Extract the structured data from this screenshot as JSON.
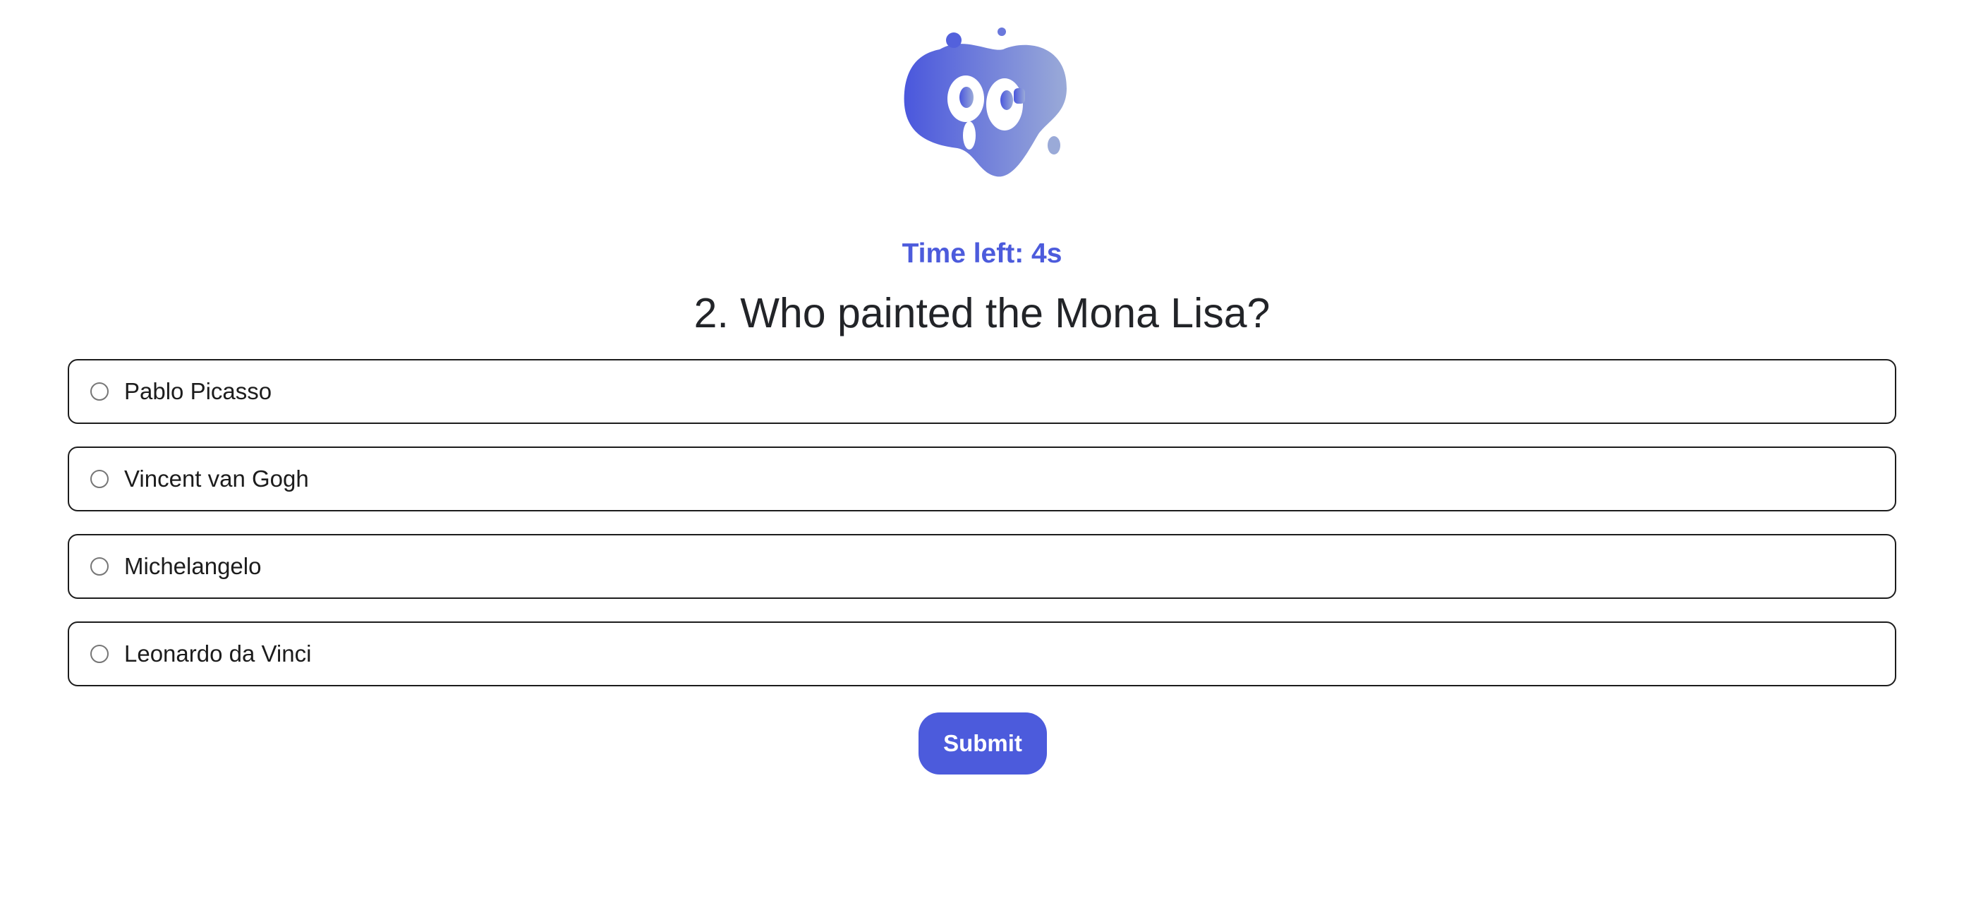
{
  "app": {
    "logo_icon": "qc-blob-logo",
    "logo_text": "QC",
    "accent_color": "#4c5bdc"
  },
  "quiz": {
    "timer_text": "Time left: 4s",
    "question": "2. Who painted the Mona Lisa?",
    "options": [
      {
        "label": "Pablo Picasso",
        "selected": false
      },
      {
        "label": "Vincent van Gogh",
        "selected": false
      },
      {
        "label": "Michelangelo",
        "selected": false
      },
      {
        "label": "Leonardo da Vinci",
        "selected": false
      }
    ],
    "submit_label": "Submit"
  }
}
